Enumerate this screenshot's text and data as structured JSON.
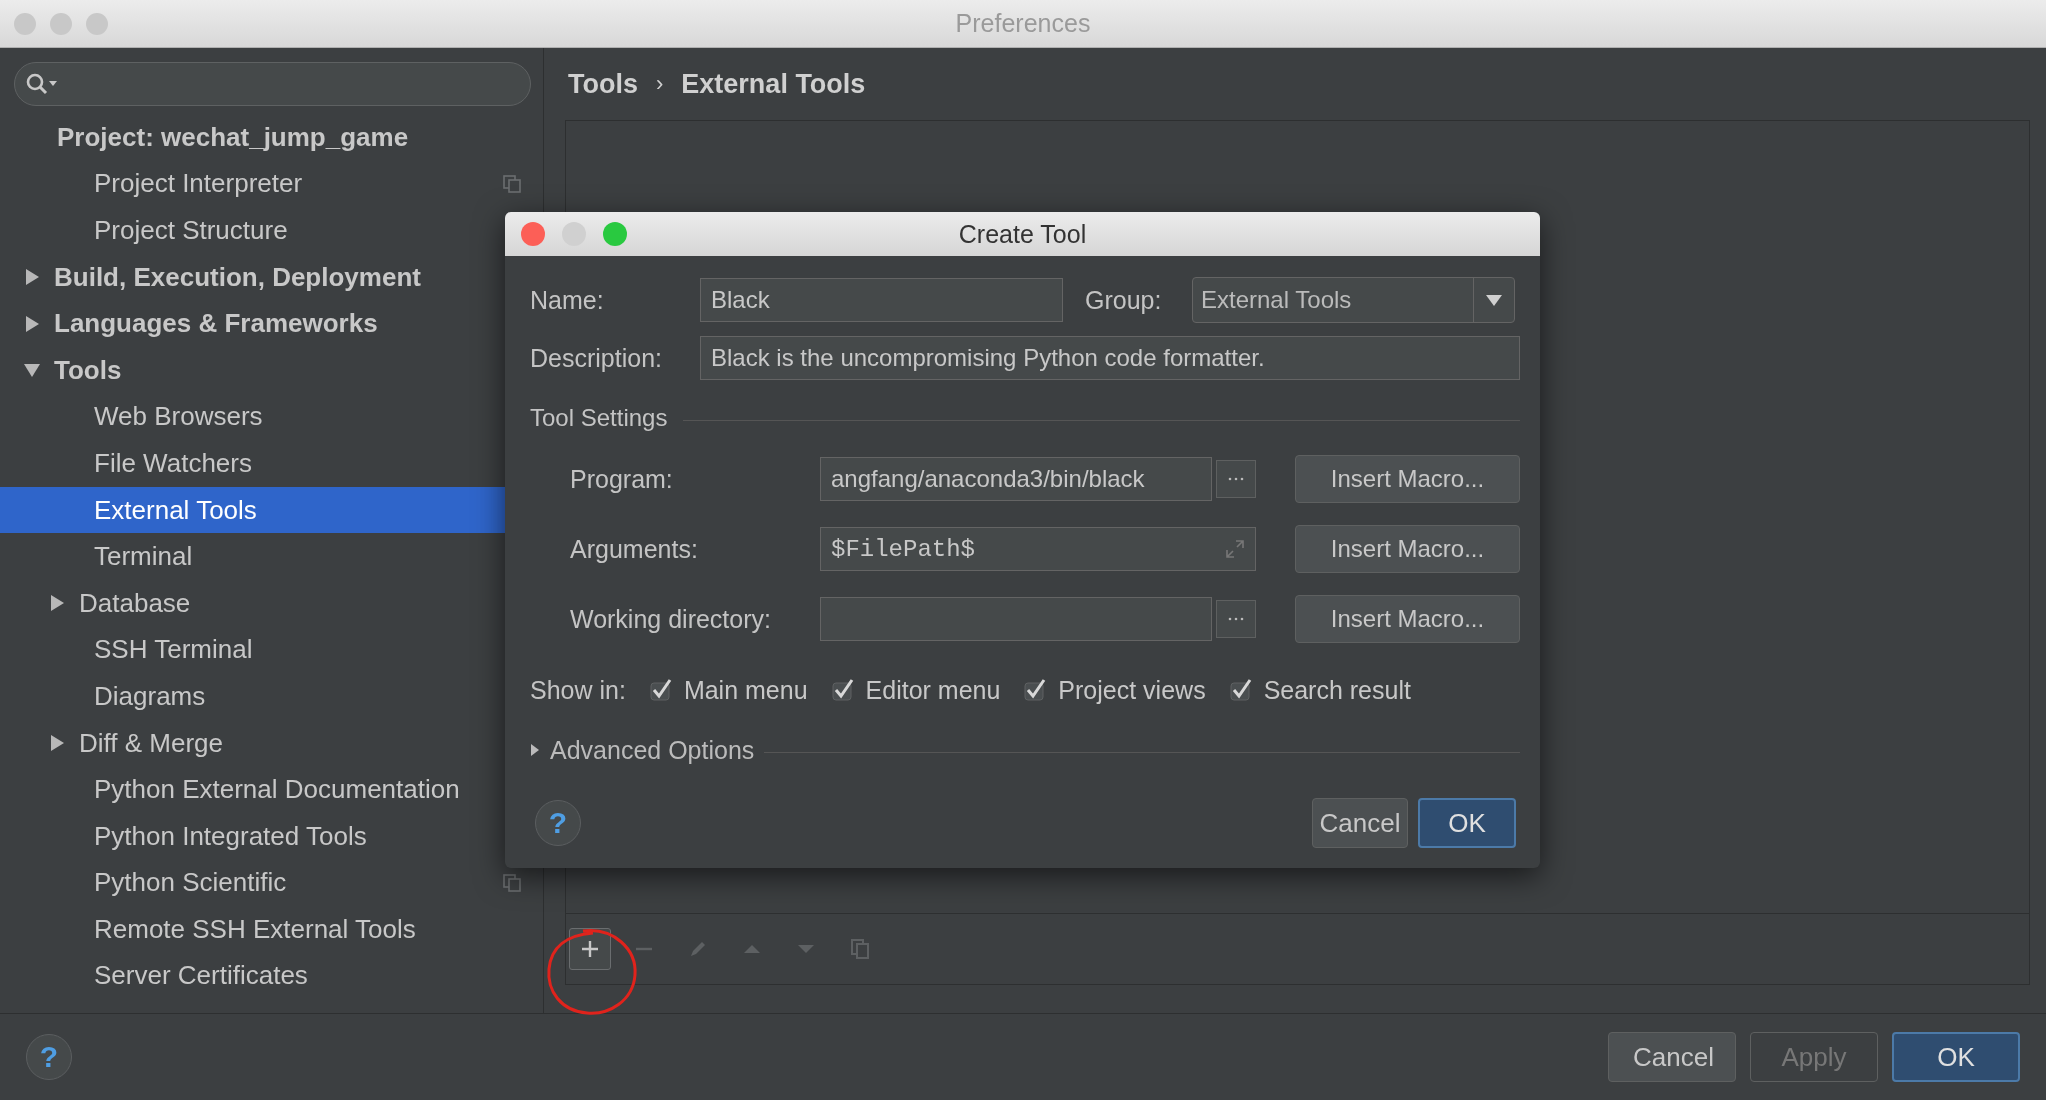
{
  "window": {
    "title": "Preferences"
  },
  "sidebar": {
    "items": [
      {
        "label": "Project: wechat_jump_game",
        "selected": false,
        "children": [
          {
            "label": "Project Interpreter",
            "selected": false,
            "project_scoped": true
          },
          {
            "label": "Project Structure",
            "selected": false,
            "project_scoped": false
          }
        ]
      },
      {
        "label": "Build, Execution, Deployment",
        "selected": false,
        "expanded": false
      },
      {
        "label": "Languages & Frameworks",
        "selected": false,
        "expanded": false
      },
      {
        "label": "Tools",
        "selected": false,
        "expanded": true,
        "children": [
          {
            "label": "Web Browsers",
            "selected": false,
            "project_scoped": false
          },
          {
            "label": "File Watchers",
            "selected": false,
            "project_scoped": false
          },
          {
            "label": "External Tools",
            "selected": true,
            "project_scoped": false
          },
          {
            "label": "Terminal",
            "selected": false,
            "project_scoped": false
          },
          {
            "label": "Database",
            "selected": false,
            "expanded": false,
            "project_scoped": false
          },
          {
            "label": "SSH Terminal",
            "selected": false,
            "project_scoped": false
          },
          {
            "label": "Diagrams",
            "selected": false,
            "project_scoped": false
          },
          {
            "label": "Diff & Merge",
            "selected": false,
            "expanded": false,
            "project_scoped": false
          },
          {
            "label": "Python External Documentation",
            "selected": false,
            "project_scoped": false
          },
          {
            "label": "Python Integrated Tools",
            "selected": false,
            "project_scoped": false
          },
          {
            "label": "Python Scientific",
            "selected": false,
            "project_scoped": true
          },
          {
            "label": "Remote SSH External Tools",
            "selected": false,
            "project_scoped": false
          },
          {
            "label": "Server Certificates",
            "selected": false,
            "project_scoped": false
          }
        ]
      }
    ]
  },
  "breadcrumb": [
    "Tools",
    "›",
    "External Tools"
  ],
  "help_button": "?",
  "toolbar": [
    {
      "kind": "add",
      "disabled": false
    },
    {
      "kind": "remove",
      "disabled": true
    },
    {
      "kind": "edit",
      "disabled": true
    },
    {
      "kind": "up",
      "disabled": true
    },
    {
      "kind": "down",
      "disabled": true
    },
    {
      "kind": "copy",
      "disabled": true
    }
  ],
  "dialog": {
    "title": "Create Tool",
    "help_button": "?",
    "name": {
      "label": "Name:",
      "value": "Black"
    },
    "group": {
      "label": "Group:",
      "value": "External Tools"
    },
    "description": {
      "label": "Description:",
      "value": "Black is the uncompromising Python code formatter."
    },
    "section": "Tool Settings",
    "settings": [
      {
        "label": "Program:",
        "value": "angfang/anaconda3/bin/black",
        "kind": "browse",
        "button": "Insert Macro..."
      },
      {
        "label": "Arguments:",
        "value": "$FilePath$",
        "kind": "expand",
        "button": "Insert Macro..."
      },
      {
        "label": "Working directory:",
        "kind": "browse",
        "button": "Insert Macro..."
      }
    ],
    "show_in": {
      "label": "Show in:",
      "options": [
        {
          "label": "Main menu",
          "checked": true
        },
        {
          "label": "Editor menu",
          "checked": true
        },
        {
          "label": "Project views",
          "checked": true
        },
        {
          "label": "Search result",
          "checked": true
        }
      ]
    },
    "advanced": {
      "label": "Advanced Options",
      "expanded": false
    },
    "buttons": [
      {
        "label": "Cancel",
        "kind": "normal"
      },
      {
        "label": "OK",
        "kind": "default"
      }
    ]
  },
  "footer_buttons": [
    {
      "label": "Cancel",
      "kind": "normal",
      "disabled": false
    },
    {
      "label": "Apply",
      "kind": "normal",
      "disabled": true
    },
    {
      "label": "OK",
      "kind": "default",
      "disabled": false
    }
  ]
}
